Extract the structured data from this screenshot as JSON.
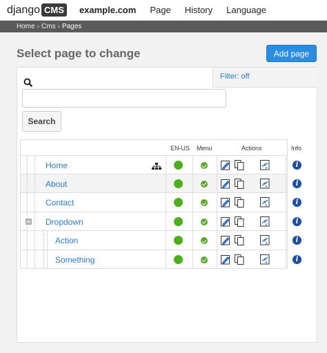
{
  "toolbar": {
    "logo_text": "django",
    "logo_box": "CMS",
    "site": "example.com",
    "menu": [
      "Page",
      "History",
      "Language"
    ]
  },
  "breadcrumb": [
    "Home",
    "Cms",
    "Pages"
  ],
  "header": {
    "title": "Select page to change",
    "add_label": "Add page"
  },
  "filter": {
    "label": "Filter: off"
  },
  "search": {
    "value": "",
    "placeholder": "",
    "button_label": "Search"
  },
  "table": {
    "columns": {
      "lang": "EN-US",
      "menu": "Menu",
      "actions": "Actions",
      "info": "Info"
    },
    "rows": [
      {
        "title": "Home",
        "level": 0
      },
      {
        "title": "About",
        "level": 0
      },
      {
        "title": "Contact",
        "level": 0
      },
      {
        "title": "Dropdown",
        "level": 0
      },
      {
        "title": "Action",
        "level": 1
      },
      {
        "title": "Something",
        "level": 1
      }
    ]
  },
  "colors": {
    "accent": "#2b8ce0",
    "link": "#2b7cd0",
    "published": "#4caf1b",
    "info": "#1c4ea8"
  }
}
